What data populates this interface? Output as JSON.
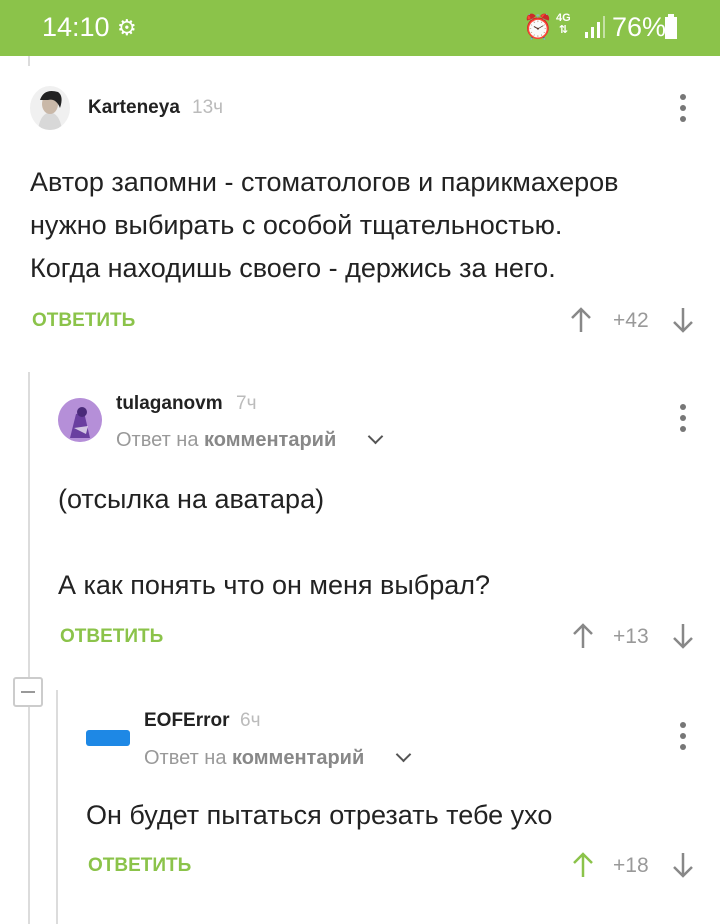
{
  "status_bar": {
    "time": "14:10",
    "network": "4G",
    "battery": "76%"
  },
  "comments": [
    {
      "username": "Karteneya",
      "time": "13ч",
      "lines": [
        "Автор запомни - стоматологов и парикмахеров",
        "нужно выбирать с особой тщательностью.",
        "Когда находишь своего - держись за него."
      ],
      "reply_label": "ОТВЕТИТЬ",
      "rating": "+42"
    },
    {
      "username": "tulaganovm",
      "time": "7ч",
      "reply_to_prefix": "Ответ на",
      "reply_to_target": "комментарий",
      "lines": [
        "(отсылка на аватара)",
        "",
        "А как понять что он меня выбрал?"
      ],
      "reply_label": "ОТВЕТИТЬ",
      "rating": "+13"
    },
    {
      "username": "EOFError",
      "time": "6ч",
      "reply_to_prefix": "Ответ на",
      "reply_to_target": "комментарий",
      "lines": [
        "Он будет пытаться отрезать тебе ухо"
      ],
      "reply_label": "ОТВЕТИТЬ",
      "rating": "+18",
      "upvoted": true
    }
  ],
  "colors": {
    "accent": "#8bc34a",
    "text": "#222222",
    "muted": "#999999",
    "thread_line": "#dcdcdc"
  }
}
